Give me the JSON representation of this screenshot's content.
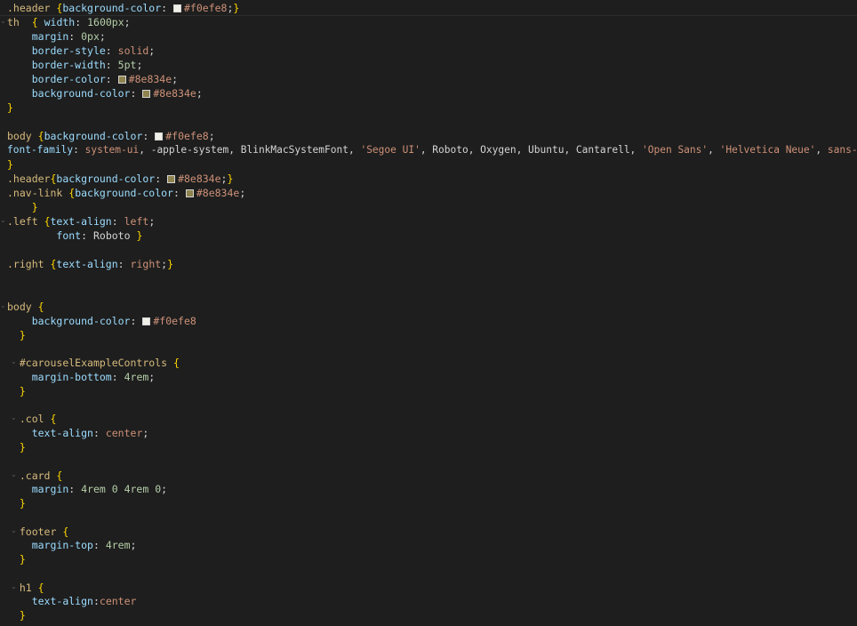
{
  "code": {
    "line1": {
      "sel": ".header",
      "brace": "{",
      "prop": "background-color",
      "colon": ":",
      "swatch": "#f0efe8",
      "value": "#f0efe8",
      "semi": ";",
      "close": "}"
    },
    "line2": {
      "sel": "th",
      "brace": "{",
      "prop": "width",
      "colon": ":",
      "value": "1600px",
      "semi": ";"
    },
    "line3": {
      "prop": "margin",
      "colon": ":",
      "value": "0px",
      "semi": ";"
    },
    "line4": {
      "prop": "border-style",
      "colon": ":",
      "value": "solid",
      "semi": ";"
    },
    "line5": {
      "prop": "border-width",
      "colon": ":",
      "value": "5pt",
      "semi": ";"
    },
    "line6": {
      "prop": "border-color",
      "colon": ":",
      "swatch": "#8e834e",
      "value": "#8e834e",
      "semi": ";"
    },
    "line7": {
      "prop": "background-color",
      "colon": ":",
      "swatch": "#8e834e",
      "value": "#8e834e",
      "semi": ";"
    },
    "line8": {
      "close": "}"
    },
    "line10": {
      "sel": "body",
      "brace": "{",
      "prop": "background-color",
      "colon": ":",
      "swatch": "#f0efe8",
      "value": "#f0efe8",
      "semi": ";"
    },
    "line11": {
      "prop": "font-family",
      "colon": ":",
      "v1": "system-ui",
      "c1": ", ",
      "v2": "-apple-system, BlinkMacSystemFont, ",
      "v3": "'Segoe UI'",
      "c3": ", Roboto, Oxygen, Ubuntu, Cantarell, ",
      "v4": "'Open Sans'",
      "c4": ", ",
      "v5": "'Helvetica Neue'",
      "c5": ", ",
      "v6": "sans-serif"
    },
    "line12": {
      "close": "}"
    },
    "line13": {
      "sel": ".header",
      "brace": "{",
      "prop": "background-color",
      "colon": ":",
      "swatch": "#8e834e",
      "value": "#8e834e",
      "semi": ";",
      "close": "}"
    },
    "line14": {
      "sel": ".nav-link",
      "brace": "{",
      "prop": "background-color",
      "colon": ":",
      "swatch": "#8e834e",
      "value": "#8e834e",
      "semi": ";"
    },
    "line15": {
      "close": "}"
    },
    "line16": {
      "sel": ".left",
      "brace": "{",
      "prop": "text-align",
      "colon": ":",
      "value": "left",
      "semi": ";"
    },
    "line17": {
      "prop": "font",
      "colon": ":",
      "value": "Roboto",
      "close": "}"
    },
    "line19": {
      "sel": ".right",
      "brace": "{",
      "prop": "text-align",
      "colon": ":",
      "value": "right",
      "semi": ";",
      "close": "}"
    },
    "line22": {
      "sel": "body",
      "brace": "{"
    },
    "line23": {
      "prop": "background-color",
      "colon": ":",
      "swatch": "#f0efe8",
      "value": "#f0efe8"
    },
    "line24": {
      "close": "}"
    },
    "line26": {
      "sel": "#carouselExampleControls",
      "brace": "{"
    },
    "line27": {
      "prop": "margin-bottom",
      "colon": ":",
      "value": "4rem",
      "semi": ";"
    },
    "line28": {
      "close": "}"
    },
    "line30": {
      "sel": ".col",
      "brace": "{"
    },
    "line31": {
      "prop": "text-align",
      "colon": ":",
      "value": "center",
      "semi": ";"
    },
    "line32": {
      "close": "}"
    },
    "line34": {
      "sel": ".card",
      "brace": "{"
    },
    "line35": {
      "prop": "margin",
      "colon": ":",
      "value": "4rem 0 4rem 0",
      "semi": ";"
    },
    "line36": {
      "close": "}"
    },
    "line38": {
      "sel": "footer",
      "brace": "{"
    },
    "line39": {
      "prop": "margin-top",
      "colon": ":",
      "value": "4rem",
      "semi": ";"
    },
    "line40": {
      "close": "}"
    },
    "line42": {
      "sel": "h1",
      "brace": "{"
    },
    "line43": {
      "prop": "text-align",
      "colon": ":",
      "value": "center"
    },
    "line44": {
      "close": "}"
    }
  },
  "colors": {
    "background": "#1e1e1e",
    "selector": "#d7ba7d",
    "property": "#9cdcfe",
    "string_value": "#ce9178",
    "number": "#b5cea8",
    "bracket": "#ffd700",
    "plain": "#d4d4d4"
  }
}
